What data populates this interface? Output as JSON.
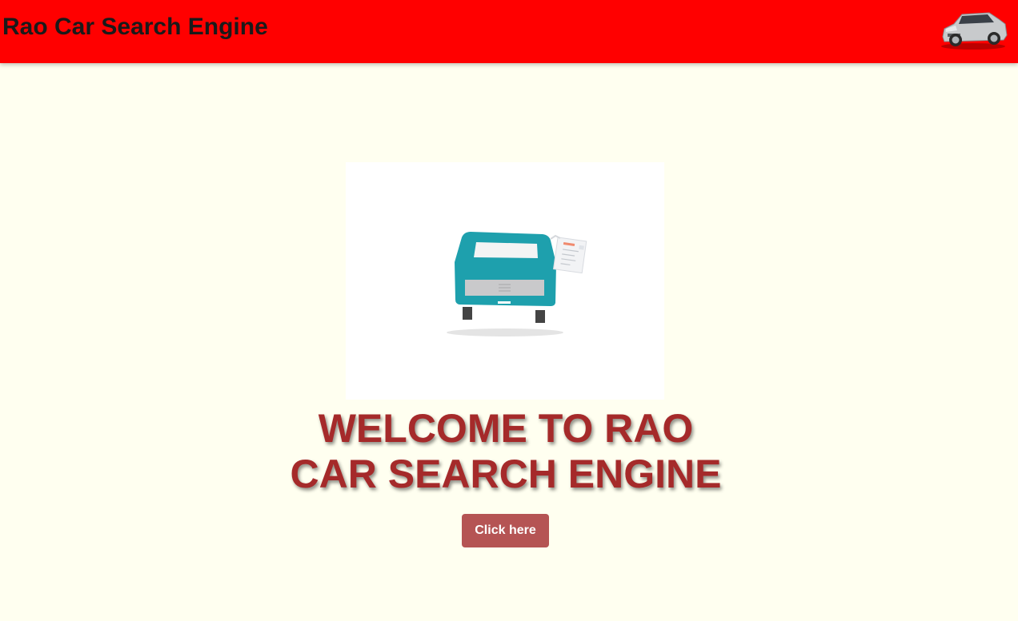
{
  "header": {
    "title": "Rao Car Search Engine",
    "logo_icon": "suv-car-icon",
    "background_color": "#ff0000"
  },
  "hero": {
    "image_icon": "teal-pickup-truck-illustration",
    "headline_line1": "WELCOME TO RAO",
    "headline_line2": "CAR SEARCH ENGINE",
    "headline_color": "#a52a2a"
  },
  "cta": {
    "label": "Click here",
    "color": "#b55454"
  },
  "page": {
    "background_color": "#fffff0"
  }
}
